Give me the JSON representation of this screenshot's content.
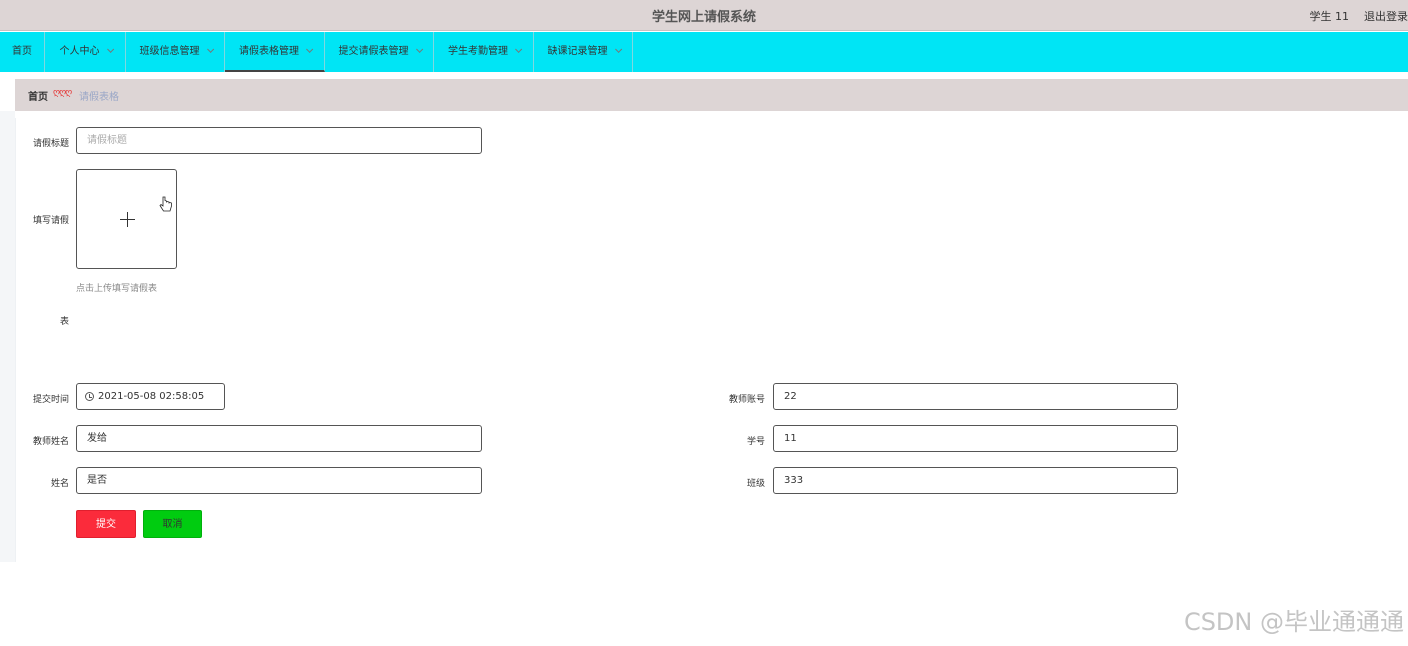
{
  "header": {
    "title": "学生网上请假系统",
    "user": "学生 11",
    "logout": "退出登录"
  },
  "nav": {
    "items": [
      {
        "label": "首页"
      },
      {
        "label": "个人中心"
      },
      {
        "label": "班级信息管理"
      },
      {
        "label": "请假表格管理"
      },
      {
        "label": "提交请假表管理"
      },
      {
        "label": "学生考勤管理"
      },
      {
        "label": "缺课记录管理"
      }
    ],
    "active": "请假表格管理"
  },
  "breadcrumb": {
    "home": "首页",
    "separator": "ღღღ",
    "current": "请假表格"
  },
  "form": {
    "title_label": "请假标题",
    "title_placeholder": "请假标题",
    "upload_label_1": "填写请假",
    "upload_label_2": "表",
    "upload_hint": "点击上传填写请假表",
    "submit_time_label": "提交时间",
    "submit_time_value": "2021-05-08 02:58:05",
    "teacher_account_label": "教师账号",
    "teacher_account_value": "22",
    "teacher_name_label": "教师姓名",
    "teacher_name_value": "发给",
    "student_no_label": "学号",
    "student_no_value": "11",
    "name_label": "姓名",
    "name_value": "是否",
    "class_label": "班级",
    "class_value": "333",
    "submit_button": "提交",
    "cancel_button": "取消"
  },
  "watermark": "CSDN @毕业通通通",
  "colors": {
    "nav_bg": "#00e5f5",
    "header_bg": "#ddd5d5",
    "submit": "#fb2b3b",
    "cancel": "#00cc10"
  }
}
